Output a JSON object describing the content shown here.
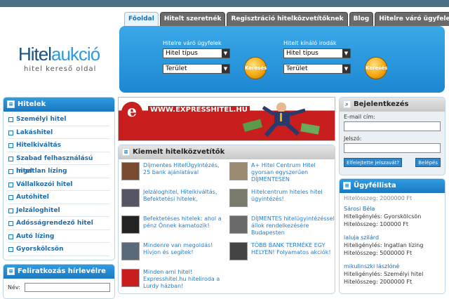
{
  "brand": {
    "logo_part1": "Hitel",
    "logo_part2": "aukció",
    "tagline": "hitel kereső oldal"
  },
  "tabs": [
    {
      "label": "Főoldal"
    },
    {
      "label": "Hitelt szeretnék"
    },
    {
      "label": "Regisztráció hitelközvetítőknek"
    },
    {
      "label": "Blog"
    },
    {
      "label": "Hitelre váró ügyfelek"
    }
  ],
  "search": {
    "left": {
      "label": "Hitelre váró ügyfelek",
      "select1": "Hitel típus",
      "select2": "Terület",
      "button": "Keresés"
    },
    "right": {
      "label": "Hitelt kínáló irodák",
      "select1": "Hitel típus",
      "select2": "Terület",
      "button": "Keresés"
    }
  },
  "hitelek": {
    "title": "Hitelek",
    "items": [
      "Személyi hitel",
      "Lakáshitel",
      "Hitelkiváltás",
      "Szabad felhasználású hitel",
      "Ingatlan lízing",
      "Vállalkozói hitel",
      "Autóhitel",
      "Jelzáloghitel",
      "Adósságrendező hitel",
      "Autó lízing",
      "Gyorskölcsön"
    ]
  },
  "hirlevel": {
    "title": "Feliratkozás hírlevélre",
    "name_label": "Név:"
  },
  "banner": {
    "logo": "e",
    "text": "WWW.EXPRESSHITEL.HU"
  },
  "kiemelt": {
    "title": "Kiemelt hitelközvetítők",
    "items": [
      {
        "text": "Díjmentes HitelÜgyintézés, 25 bank ajánlatával",
        "thumb_color": "#7a4a30"
      },
      {
        "text": "A+ Hitel Centrum Hitel gyorsan egyszerűen DÍJMENTESEN",
        "thumb_color": "#9a8a70"
      },
      {
        "text": "Jelzáloghitel, Hitelkiváltás, Befektetési hitelek,",
        "thumb_color": "#556"
      },
      {
        "text": "Hitelcentrum hiteles hitel ügyintézés!",
        "thumb_color": "#7a7a6a"
      },
      {
        "text": "Befektetéses hitelek: ahol a pénz Önnek kamatozik!",
        "thumb_color": "#222"
      },
      {
        "text": "DÍJMENTES hitelügyintézéssel állok rendelkezésére Budapesten",
        "thumb_color": "#6a6a6a"
      },
      {
        "text": "Mindenre van megoldás! Hívjon és segítek!",
        "thumb_color": "#5a6a7a"
      },
      {
        "text": "TÖBB BANK TERMÉKE EGY HELYEN! Folyamatos akciók!",
        "thumb_color": "#444"
      },
      {
        "text": "Minden ami hitel! Expresshitel.hu hiteliroda a Lurdy házban!",
        "thumb_color": "#c81e1e"
      }
    ]
  },
  "login": {
    "title": "Bejelentkezés",
    "email_label": "E-mail cím:",
    "password_label": "Jelszó:",
    "forgot_button": "Elfelejtette jelszavát?",
    "login_button": "Belépés"
  },
  "ugyfellista": {
    "title": "Ügyféllista",
    "partial": "Hitelösszeg: 2000000 Ft",
    "entries": [
      {
        "name": "Sárosi Béla",
        "type": "Hiteligénylés: Gyorskölcsön",
        "amount": "Hitelösszeg: 100000 Ft"
      },
      {
        "name": "laluja szilárd",
        "type": "Hiteligénylés: Ingatlan lízing",
        "amount": "Hitelösszeg: 5000000 Ft"
      },
      {
        "name": "mikulinszki lászlóné",
        "type": "Hiteligénylés: Személyi hitel",
        "amount": "Hitelösszeg: 2000000 Ft"
      }
    ]
  },
  "colors": {
    "accent": "#1b78bf",
    "panel": "#2a9be0",
    "banner_red": "#c81e1e"
  }
}
